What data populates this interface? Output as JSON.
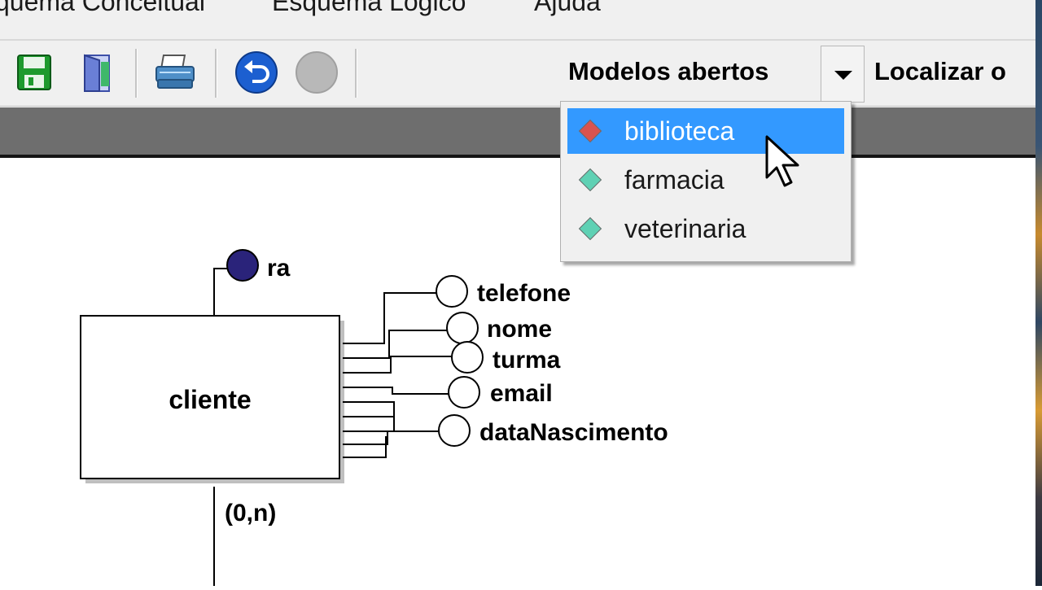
{
  "menubar": {
    "items": [
      "quema Conceitual",
      "Esquema Lógico",
      "Ajuda"
    ]
  },
  "toolbar": {
    "buttons": [
      {
        "name": "save-icon",
        "color": "#1e9a2e"
      },
      {
        "name": "exit-door-icon",
        "color": "#6a7fd6"
      },
      {
        "name": "printer-icon",
        "color": "#4f8fc8"
      },
      {
        "name": "undo-icon",
        "color": "#1c5fd0"
      },
      {
        "name": "redo-icon",
        "color": "#b8b8b8"
      }
    ],
    "models_label": "Modelos abertos",
    "locate_label": "Localizar o"
  },
  "models_menu": {
    "items": [
      {
        "label": "biblioteca",
        "selected": true,
        "icon_color": "#d9534f"
      },
      {
        "label": "farmacia",
        "selected": false,
        "icon_color": "#5fd1b4"
      },
      {
        "label": "veterinaria",
        "selected": false,
        "icon_color": "#5fd1b4"
      }
    ],
    "highlight_color": "#3399ff"
  },
  "diagram": {
    "entity": {
      "name": "cliente"
    },
    "identifier": {
      "name": "ra"
    },
    "attributes": [
      "telefone",
      "nome",
      "turma",
      "email",
      "dataNascimento"
    ],
    "cardinality": "(0,n)"
  }
}
